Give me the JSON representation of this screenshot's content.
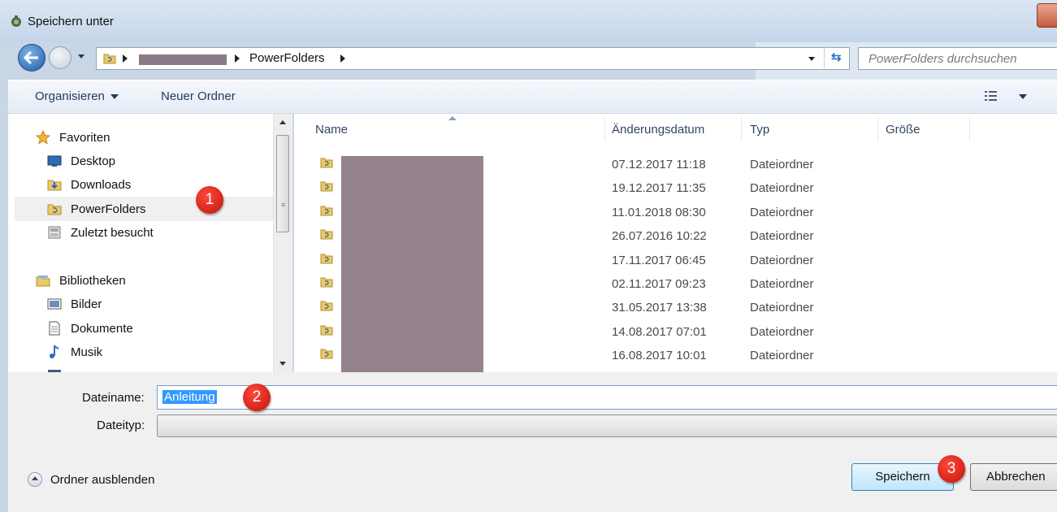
{
  "window": {
    "title": "Speichern unter"
  },
  "address": {
    "breadcrumbs": [
      "PowerFolders"
    ],
    "search_placeholder": "PowerFolders durchsuchen"
  },
  "toolbar": {
    "organize_label": "Organisieren",
    "new_folder_label": "Neuer Ordner"
  },
  "nav": {
    "favorites": {
      "label": "Favoriten"
    },
    "desktop": {
      "label": "Desktop"
    },
    "downloads": {
      "label": "Downloads"
    },
    "powerfolders": {
      "label": "PowerFolders"
    },
    "recent": {
      "label": "Zuletzt besucht"
    },
    "libraries": {
      "label": "Bibliotheken"
    },
    "pictures": {
      "label": "Bilder"
    },
    "documents": {
      "label": "Dokumente"
    },
    "music": {
      "label": "Musik"
    }
  },
  "columns": {
    "name": "Name",
    "date": "Änderungsdatum",
    "type": "Typ",
    "size": "Größe"
  },
  "files": [
    {
      "date": "07.12.2017 11:18",
      "type": "Dateiordner"
    },
    {
      "date": "19.12.2017 11:35",
      "type": "Dateiordner"
    },
    {
      "date": "11.01.2018 08:30",
      "type": "Dateiordner"
    },
    {
      "date": "26.07.2016 10:22",
      "type": "Dateiordner"
    },
    {
      "date": "17.11.2017 06:45",
      "type": "Dateiordner"
    },
    {
      "date": "02.11.2017 09:23",
      "type": "Dateiordner"
    },
    {
      "date": "31.05.2017 13:38",
      "type": "Dateiordner"
    },
    {
      "date": "14.08.2017 07:01",
      "type": "Dateiordner"
    },
    {
      "date": "16.08.2017 10:01",
      "type": "Dateiordner"
    }
  ],
  "form": {
    "filename_label": "Dateiname:",
    "filename_value": "Anleitung",
    "filetype_label": "Dateityp:"
  },
  "footer": {
    "hide_folders_label": "Ordner ausblenden",
    "save_label": "Speichern",
    "cancel_label": "Abbrechen"
  },
  "annotations": {
    "badge1": "1",
    "badge2": "2",
    "badge3": "3",
    "color": "#e0201a"
  }
}
